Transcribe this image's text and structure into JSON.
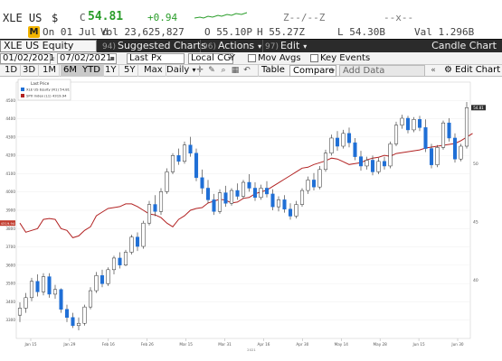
{
  "quote": {
    "ticker": "XLE US",
    "currency_symbol": "$",
    "close_label": "C",
    "last_price": "54.81",
    "net_change": "+0.94",
    "z_marks": "Z--/--Z",
    "x_marks": "--x--",
    "date_prefix": "On 01 Jul d",
    "volume": "Vol 23,625,827",
    "open": "O 55.10P",
    "high": "H 55.27Z",
    "low": "L 54.30B",
    "value": "Val 1.296B",
    "icon_letter": "M"
  },
  "title_bar": {
    "security": "XLE US Equity",
    "suggested_num": "94)",
    "suggested": "Suggested Charts",
    "actions_num": "96)",
    "actions": "Actions",
    "edit_num": "97)",
    "edit": "Edit",
    "chart_type": "Candle Chart"
  },
  "options": {
    "start_date": "01/02/2021",
    "end_date": "07/02/2021",
    "field": "Last Px",
    "currency": "Local CCY",
    "mov_avgs": "Mov Avgs",
    "key_events": "Key Events"
  },
  "toolbar": {
    "periods": [
      "1D",
      "3D",
      "1M",
      "6M",
      "YTD",
      "1Y",
      "5Y",
      "Max"
    ],
    "active_period": "6M",
    "frequency": "Daily",
    "table": "Table",
    "compare": "Compare",
    "add_data": "Add Data",
    "edit_chart": "Edit Chart"
  },
  "legend": {
    "header": "Last Price",
    "series": [
      {
        "label": "XLE US Equity  (R1)  54.81"
      },
      {
        "label": "SPX Index  (L1)  4319.94"
      }
    ]
  },
  "colors": {
    "candle_up": "#ffffff",
    "candle_down": "#1f6fd6",
    "spx_line": "#b22222",
    "last_tag": "#2f2f2f",
    "spx_tag": "#c0392b"
  },
  "chart_data": {
    "type": "candlestick",
    "x_ticks": [
      "Jan 15",
      "Jan 29",
      "Feb 16",
      "Feb 26",
      "Mar 15",
      "Mar 31",
      "Apr 16",
      "Apr 30",
      "May 14",
      "May 28",
      "Jun 15",
      "Jun 30"
    ],
    "x_axis_label": "2021",
    "left_axis_ticks": [
      "3300",
      "3400",
      "3500",
      "3600",
      "3700",
      "3800",
      "3900",
      "4000",
      "4100",
      "4200",
      "4300",
      "4400",
      "4500"
    ],
    "left_ylim": [
      3200,
      4600
    ],
    "right_axis_ticks": [
      "40",
      "45",
      "50"
    ],
    "right_ylim": [
      35,
      57
    ],
    "last_value_tag": "54.81",
    "spx_value_tag": "4319.94",
    "xle_series": [
      [
        37.0,
        38.1,
        36.4,
        37.6
      ],
      [
        37.6,
        38.9,
        37.2,
        38.5
      ],
      [
        38.5,
        40.2,
        38.2,
        39.9
      ],
      [
        39.9,
        40.5,
        38.6,
        39.0
      ],
      [
        39.0,
        40.6,
        38.7,
        40.3
      ],
      [
        40.3,
        40.6,
        38.5,
        38.8
      ],
      [
        38.8,
        39.6,
        38.4,
        39.2
      ],
      [
        39.2,
        39.3,
        37.2,
        37.5
      ],
      [
        37.5,
        37.9,
        36.4,
        36.8
      ],
      [
        36.8,
        37.2,
        35.9,
        36.1
      ],
      [
        36.1,
        36.8,
        35.7,
        36.3
      ],
      [
        36.3,
        37.9,
        36.1,
        37.7
      ],
      [
        37.7,
        39.4,
        37.5,
        39.1
      ],
      [
        39.1,
        40.7,
        38.9,
        40.4
      ],
      [
        40.4,
        40.9,
        39.4,
        39.7
      ],
      [
        39.7,
        41.1,
        39.5,
        40.9
      ],
      [
        40.9,
        42.1,
        40.5,
        41.9
      ],
      [
        41.9,
        42.4,
        41.0,
        41.3
      ],
      [
        41.3,
        42.6,
        41.2,
        42.4
      ],
      [
        42.4,
        43.9,
        42.2,
        43.7
      ],
      [
        43.7,
        44.1,
        42.5,
        42.9
      ],
      [
        42.9,
        45.1,
        42.7,
        44.9
      ],
      [
        44.9,
        46.8,
        44.7,
        46.5
      ],
      [
        46.5,
        47.3,
        45.5,
        45.9
      ],
      [
        45.9,
        47.9,
        45.6,
        47.6
      ],
      [
        47.6,
        49.6,
        47.4,
        49.3
      ],
      [
        49.3,
        50.9,
        49.1,
        50.7
      ],
      [
        50.7,
        51.3,
        49.9,
        50.2
      ],
      [
        50.2,
        51.9,
        50.0,
        51.6
      ],
      [
        51.6,
        52.3,
        50.6,
        50.9
      ],
      [
        50.9,
        51.3,
        48.5,
        48.8
      ],
      [
        48.8,
        49.5,
        47.4,
        47.9
      ],
      [
        47.9,
        48.6,
        46.6,
        46.9
      ],
      [
        46.9,
        47.4,
        45.6,
        45.9
      ],
      [
        45.9,
        47.8,
        45.7,
        47.5
      ],
      [
        47.5,
        48.1,
        46.3,
        46.6
      ],
      [
        46.6,
        47.9,
        46.4,
        47.7
      ],
      [
        47.7,
        48.3,
        46.9,
        47.2
      ],
      [
        47.2,
        48.6,
        47.0,
        48.4
      ],
      [
        48.4,
        49.1,
        47.6,
        47.9
      ],
      [
        47.9,
        48.4,
        46.8,
        47.1
      ],
      [
        47.1,
        48.2,
        46.9,
        47.9
      ],
      [
        47.9,
        48.5,
        47.1,
        47.4
      ],
      [
        47.4,
        47.8,
        46.0,
        46.3
      ],
      [
        46.3,
        47.2,
        45.9,
        46.9
      ],
      [
        46.9,
        47.3,
        45.8,
        46.1
      ],
      [
        46.1,
        46.6,
        45.2,
        45.5
      ],
      [
        45.5,
        46.8,
        45.3,
        46.5
      ],
      [
        46.5,
        47.9,
        46.3,
        47.7
      ],
      [
        47.7,
        48.9,
        47.4,
        48.6
      ],
      [
        48.6,
        49.2,
        47.7,
        48.0
      ],
      [
        48.0,
        49.8,
        47.8,
        49.5
      ],
      [
        49.5,
        51.2,
        49.3,
        50.9
      ],
      [
        50.9,
        52.5,
        50.7,
        52.2
      ],
      [
        52.2,
        52.8,
        51.1,
        51.5
      ],
      [
        51.5,
        52.9,
        51.3,
        52.6
      ],
      [
        52.6,
        53.1,
        51.4,
        51.8
      ],
      [
        51.8,
        52.2,
        50.3,
        50.6
      ],
      [
        50.6,
        51.1,
        49.4,
        49.8
      ],
      [
        49.8,
        50.6,
        49.5,
        50.3
      ],
      [
        50.3,
        50.7,
        49.0,
        49.3
      ],
      [
        49.3,
        50.5,
        49.1,
        50.2
      ],
      [
        50.2,
        50.6,
        49.5,
        49.8
      ],
      [
        49.8,
        51.9,
        49.6,
        51.7
      ],
      [
        51.7,
        53.6,
        51.5,
        53.3
      ],
      [
        53.3,
        54.2,
        53.0,
        53.9
      ],
      [
        53.9,
        54.1,
        52.6,
        52.9
      ],
      [
        52.9,
        54.0,
        52.7,
        53.8
      ],
      [
        53.8,
        54.1,
        52.8,
        53.1
      ],
      [
        53.1,
        53.8,
        51.0,
        51.3
      ],
      [
        51.3,
        51.7,
        49.6,
        49.9
      ],
      [
        49.9,
        51.6,
        49.7,
        51.4
      ],
      [
        51.4,
        53.7,
        51.2,
        53.5
      ],
      [
        53.5,
        53.9,
        51.9,
        52.2
      ],
      [
        52.2,
        52.6,
        50.1,
        50.4
      ],
      [
        50.4,
        51.7,
        50.2,
        51.5
      ],
      [
        51.5,
        55.3,
        51.3,
        54.81
      ]
    ],
    "spx_series": [
      3830,
      3780,
      3790,
      3800,
      3850,
      3855,
      3850,
      3800,
      3790,
      3750,
      3760,
      3790,
      3810,
      3870,
      3890,
      3910,
      3915,
      3920,
      3935,
      3935,
      3920,
      3900,
      3880,
      3875,
      3860,
      3830,
      3810,
      3850,
      3870,
      3900,
      3910,
      3915,
      3940,
      3950,
      3960,
      3955,
      3940,
      3945,
      3965,
      3970,
      3990,
      4000,
      4010,
      4030,
      4050,
      4070,
      4090,
      4110,
      4130,
      4135,
      4150,
      4160,
      4170,
      4185,
      4180,
      4165,
      4150,
      4155,
      4160,
      4175,
      4185,
      4190,
      4200,
      4195,
      4210,
      4215,
      4220,
      4225,
      4230,
      4240,
      4245,
      4250,
      4255,
      4260,
      4265,
      4280,
      4300,
      4319.94
    ]
  }
}
